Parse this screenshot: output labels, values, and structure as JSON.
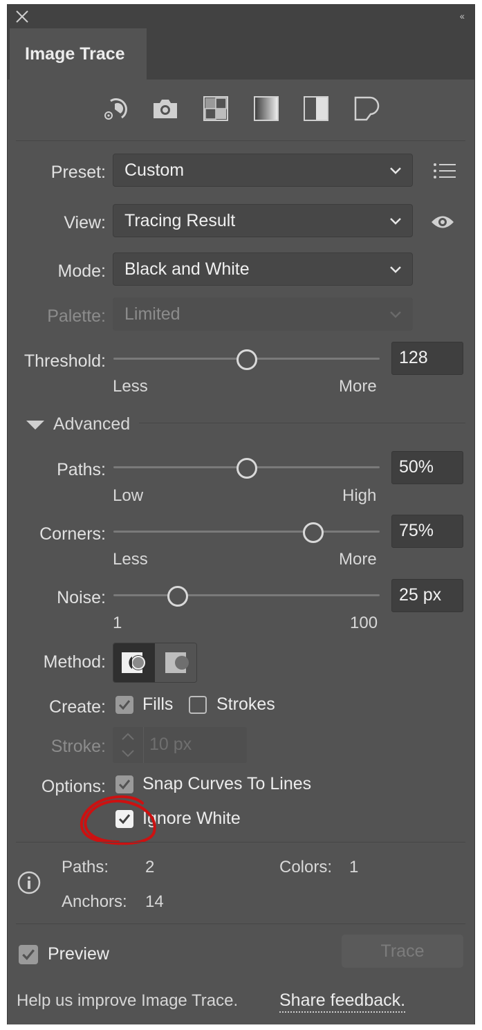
{
  "panel": {
    "tab_title": "Image Trace",
    "collapse_glyph": "‹‹"
  },
  "presets_icons": [
    "auto-color-icon",
    "high-color-icon",
    "low-color-icon",
    "grayscale-icon",
    "black-and-white-icon",
    "outline-icon"
  ],
  "preset": {
    "label": "Preset:",
    "value": "Custom"
  },
  "view": {
    "label": "View:",
    "value": "Tracing Result"
  },
  "mode": {
    "label": "Mode:",
    "value": "Black and White"
  },
  "palette": {
    "label": "Palette:",
    "value": "Limited"
  },
  "threshold": {
    "label": "Threshold:",
    "value": "128",
    "level": 128,
    "min": 0,
    "max": 255,
    "low_label": "Less",
    "high_label": "More"
  },
  "advanced": {
    "label": "Advanced"
  },
  "paths": {
    "label": "Paths:",
    "value": "50%",
    "level": 50,
    "low_label": "Low",
    "high_label": "High"
  },
  "corners": {
    "label": "Corners:",
    "value": "75%",
    "level": 75,
    "low_label": "Less",
    "high_label": "More"
  },
  "noise": {
    "label": "Noise:",
    "value": "25 px",
    "level": 25,
    "min": 1,
    "max": 100,
    "low_label": "1",
    "high_label": "100"
  },
  "method": {
    "label": "Method:",
    "selected": "abutting"
  },
  "create": {
    "label": "Create:",
    "fills_label": "Fills",
    "fills_checked": true,
    "strokes_label": "Strokes",
    "strokes_checked": false
  },
  "stroke": {
    "label": "Stroke:",
    "value": "10 px"
  },
  "options": {
    "label": "Options:",
    "snap_label": "Snap Curves To Lines",
    "snap_checked": true,
    "ignore_white_label": "Ignore White",
    "ignore_white_checked": true
  },
  "stats": {
    "paths_label": "Paths:",
    "paths_value": "2",
    "colors_label": "Colors:",
    "colors_value": "1",
    "anchors_label": "Anchors:",
    "anchors_value": "14"
  },
  "preview": {
    "label": "Preview",
    "checked": true
  },
  "trace_button": "Trace",
  "footer": {
    "help_text": "Help us improve Image Trace.",
    "link_text": "Share feedback."
  },
  "colors": {
    "panel_bg": "#535353",
    "annotation": "#cc1111"
  }
}
